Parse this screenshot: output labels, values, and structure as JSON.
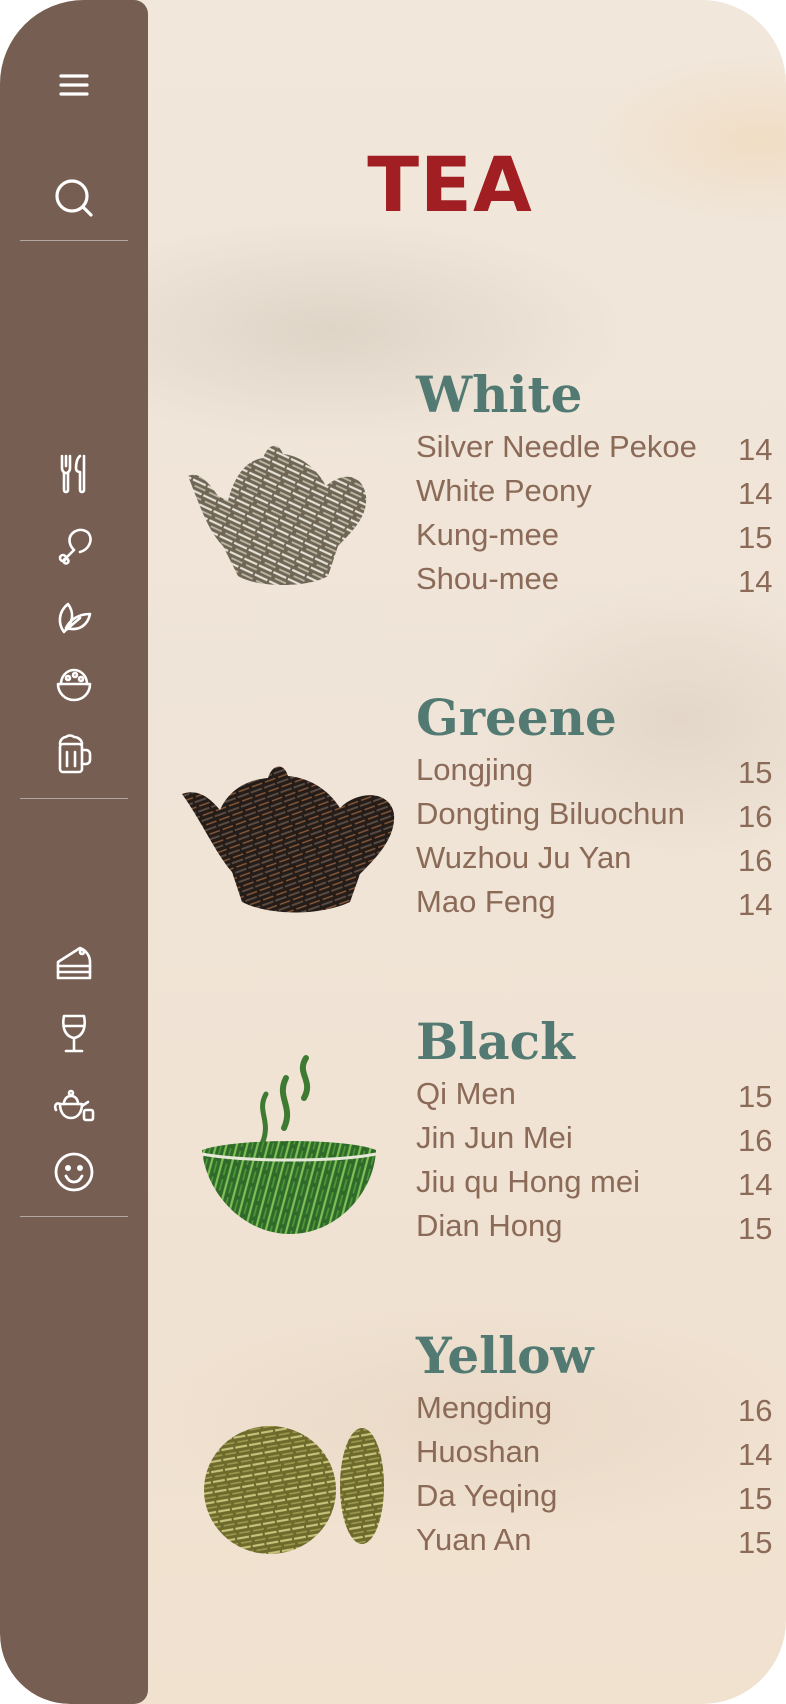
{
  "page_title": "TEA",
  "sidebar": {
    "top": [
      {
        "icon": "menu-icon"
      },
      {
        "icon": "search-icon"
      }
    ],
    "group1": [
      {
        "icon": "fork-knife-icon"
      },
      {
        "icon": "drumstick-icon"
      },
      {
        "icon": "leaf-icon"
      },
      {
        "icon": "rice-bowl-icon"
      },
      {
        "icon": "beer-mug-icon"
      }
    ],
    "group2": [
      {
        "icon": "cake-icon"
      },
      {
        "icon": "wine-glass-icon"
      },
      {
        "icon": "teapot-icon"
      },
      {
        "icon": "smiley-icon"
      }
    ]
  },
  "sections": [
    {
      "name": "White",
      "items": [
        {
          "name": "Silver Needle Pekoe",
          "price": "14"
        },
        {
          "name": "White Peony",
          "price": "14"
        },
        {
          "name": "Kung-mee",
          "price": "15"
        },
        {
          "name": "Shou-mee",
          "price": "14"
        }
      ]
    },
    {
      "name": "Greene",
      "items": [
        {
          "name": "Longjing",
          "price": "15"
        },
        {
          "name": "Dongting Biluochun",
          "price": "16"
        },
        {
          "name": "Wuzhou Ju Yan",
          "price": "16"
        },
        {
          "name": "Mao Feng",
          "price": "14"
        }
      ]
    },
    {
      "name": "Black",
      "items": [
        {
          "name": "Qi Men",
          "price": "15"
        },
        {
          "name": "Jin Jun Mei",
          "price": "16"
        },
        {
          "name": "Jiu qu Hong mei",
          "price": "14"
        },
        {
          "name": "Dian Hong",
          "price": "15"
        }
      ]
    },
    {
      "name": "Yellow",
      "items": [
        {
          "name": "Mengding",
          "price": "16"
        },
        {
          "name": "Huoshan",
          "price": "14"
        },
        {
          "name": "Da Yeqing",
          "price": "15"
        },
        {
          "name": "Yuan An",
          "price": "15"
        }
      ]
    }
  ],
  "colors": {
    "sidebar": "#765e52",
    "title": "#a11e22",
    "section_heading": "#527a72",
    "item_text": "#8b6a57",
    "background": "#efe4d7"
  }
}
